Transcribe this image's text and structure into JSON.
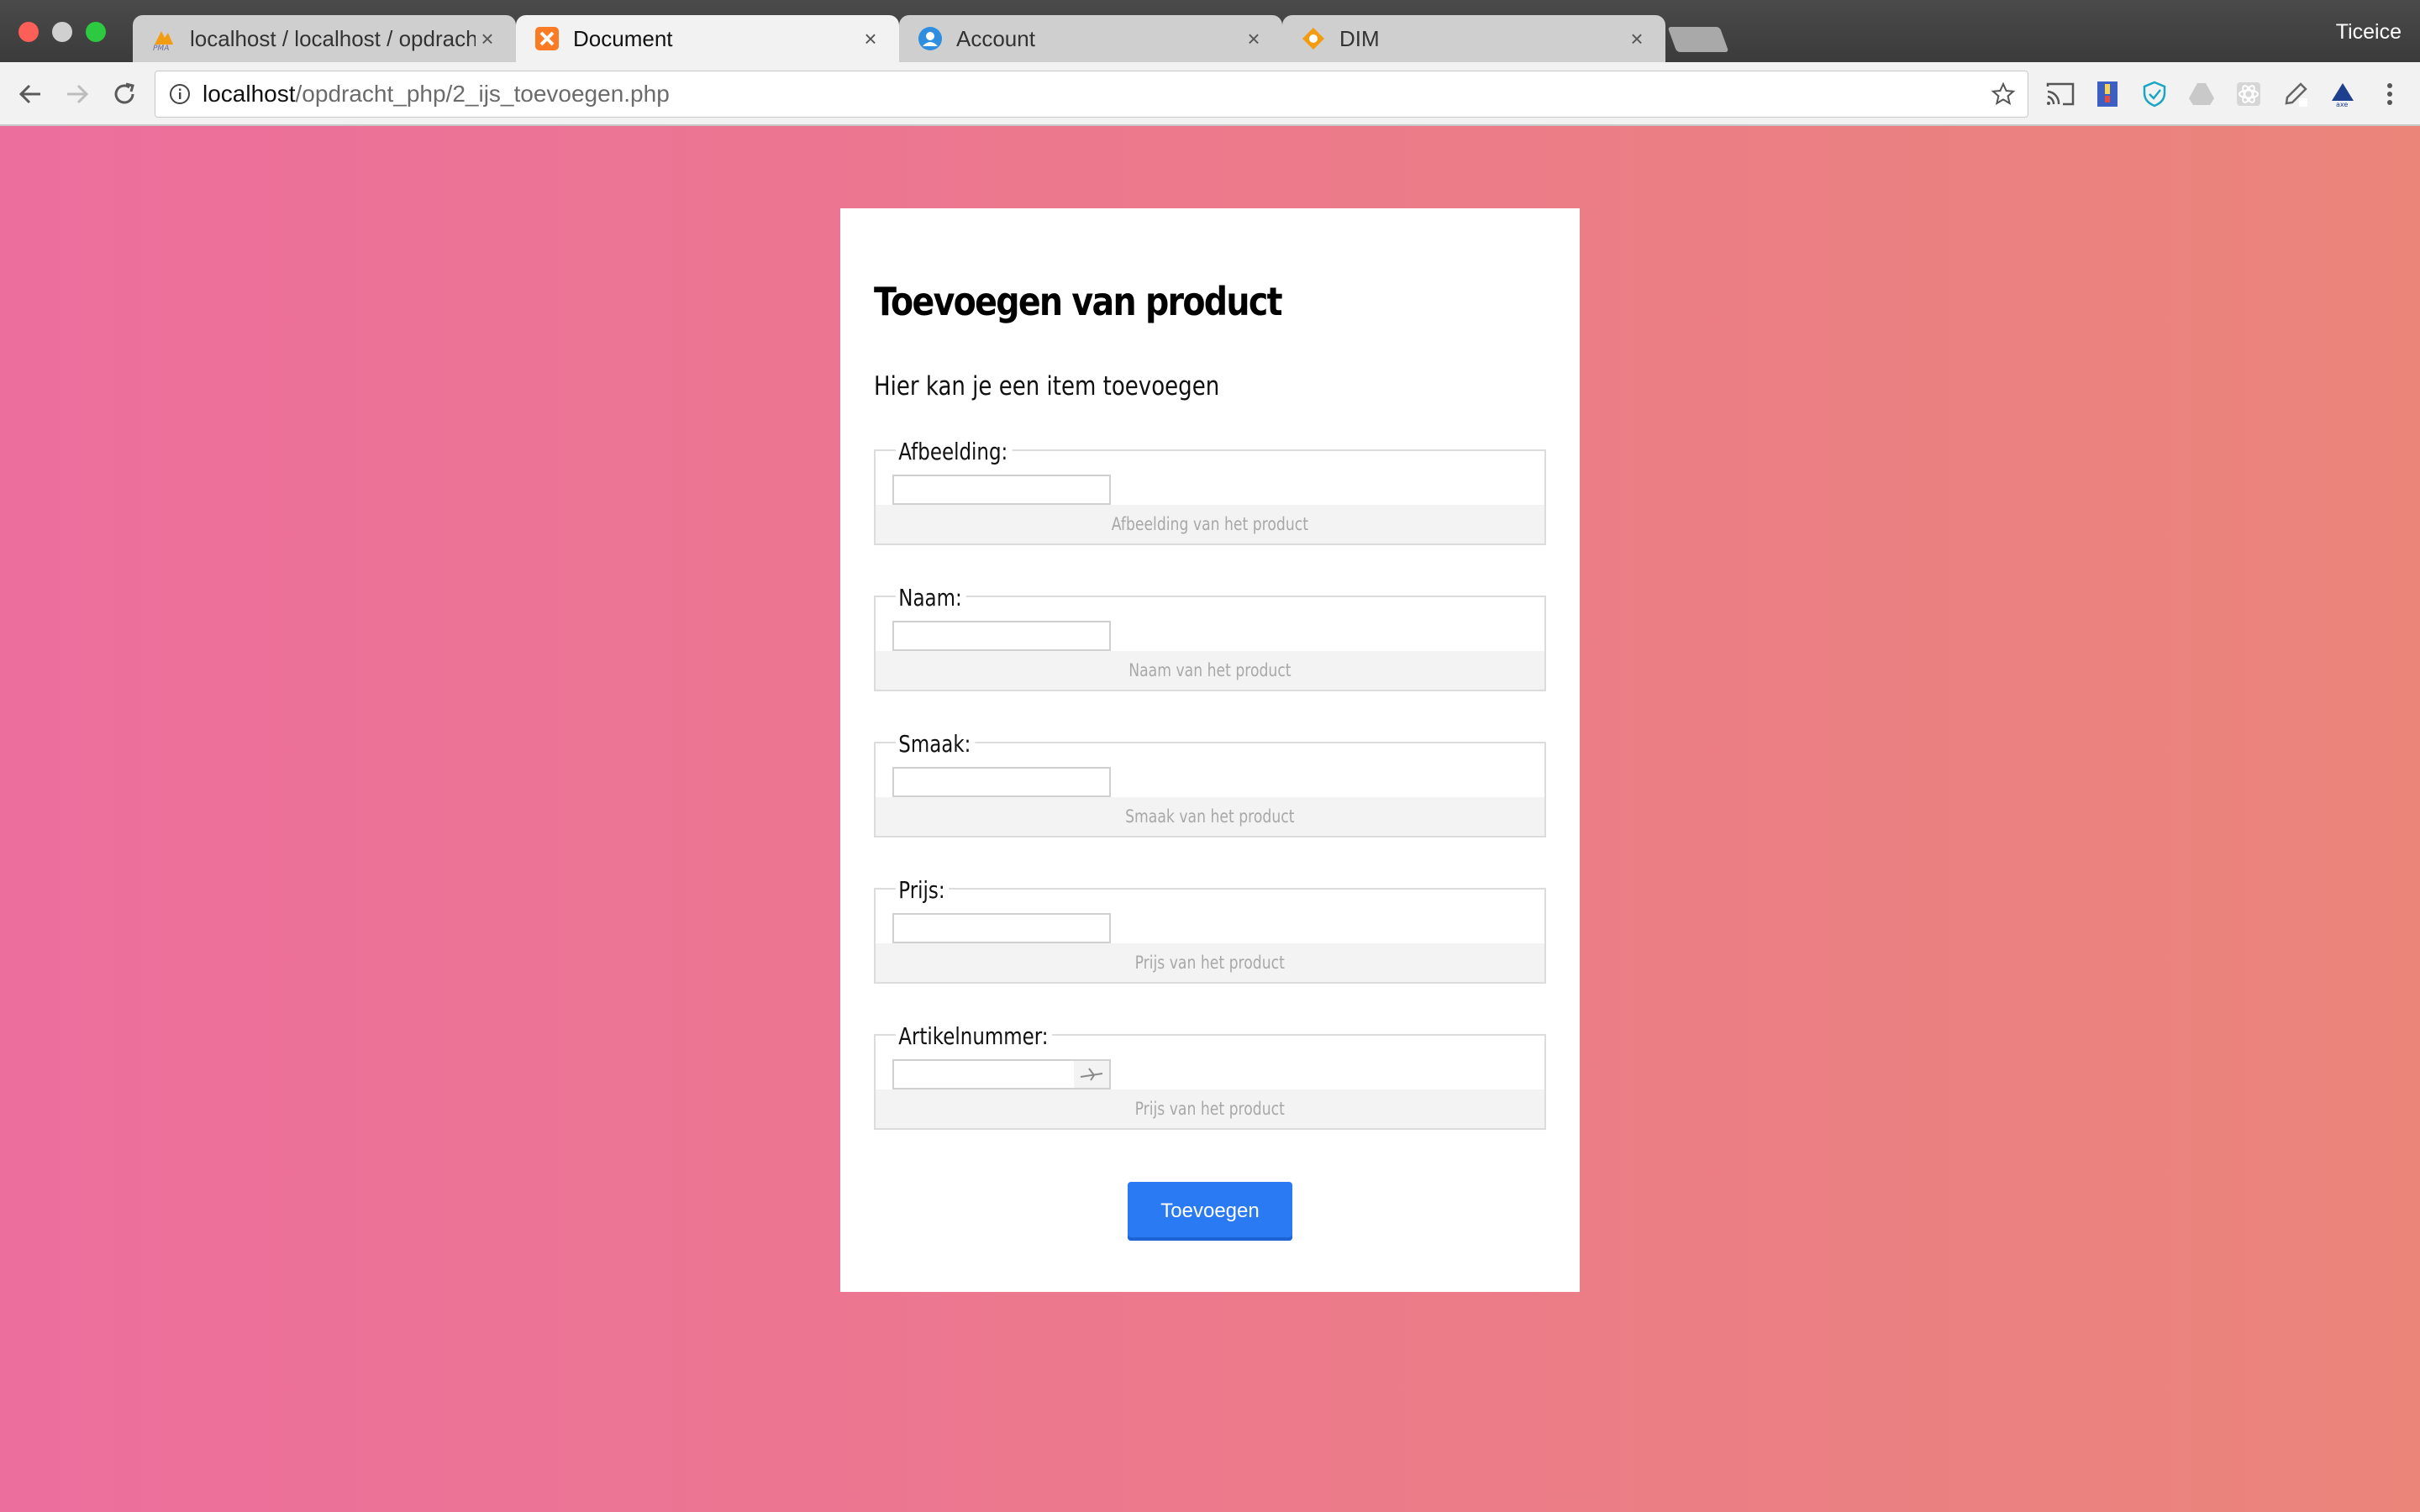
{
  "browser": {
    "tabs": [
      {
        "title": "localhost / localhost / opdracht",
        "favicon": "phpmyadmin-icon",
        "active": false
      },
      {
        "title": "Document",
        "favicon": "xampp-icon",
        "active": true
      },
      {
        "title": "Account",
        "favicon": "account-icon",
        "active": false
      },
      {
        "title": "DIM",
        "favicon": "dim-icon",
        "active": false
      }
    ],
    "profile_name": "Ticeice",
    "url": {
      "host": "localhost",
      "path": "/opdracht_php/2_ijs_toevoegen.php"
    }
  },
  "form": {
    "heading": "Toevoegen van product",
    "subtitle": "Hier kan je een item toevoegen",
    "fields": [
      {
        "label": "Afbeelding:",
        "value": "",
        "help": "Afbeelding van het product"
      },
      {
        "label": "Naam:",
        "value": "",
        "help": "Naam van het product"
      },
      {
        "label": "Smaak:",
        "value": "",
        "help": "Smaak van het product"
      },
      {
        "label": "Prijs:",
        "value": "",
        "help": "Prijs van het product"
      },
      {
        "label": "Artikelnummer:",
        "value": "",
        "help": "Prijs van het product"
      }
    ],
    "submit_label": "Toevoegen"
  },
  "colors": {
    "page_gradient_start": "#ec6e9d",
    "page_gradient_end": "#eb857a",
    "button": "#2a7af3"
  }
}
